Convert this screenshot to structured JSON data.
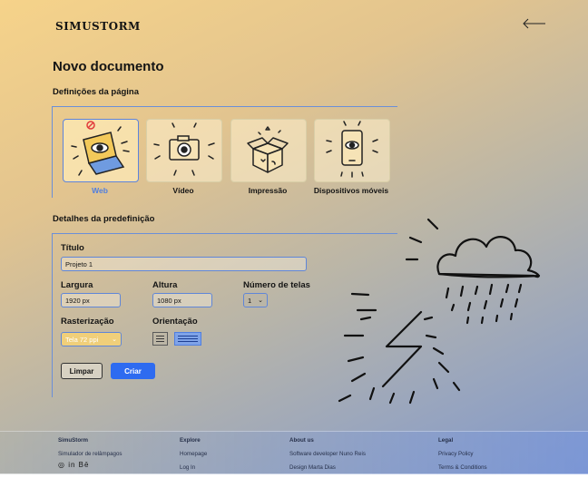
{
  "app": {
    "logo": "SIMUSTORM"
  },
  "header": {
    "back_icon": "arrow-left-icon"
  },
  "page_title": "Novo documento",
  "page_section": {
    "title": "Definições da página",
    "presets": [
      {
        "label": "Web",
        "icon": "laptop-icon",
        "selected": true
      },
      {
        "label": "Vídeo",
        "icon": "camera-icon",
        "selected": false
      },
      {
        "label": "Impressão",
        "icon": "package-icon",
        "selected": false
      },
      {
        "label": "Dispositivos móveis",
        "icon": "phone-icon",
        "selected": false
      }
    ]
  },
  "details_section": {
    "title": "Detalhes da predefinição",
    "title_label": "Título",
    "title_value": "Projeto 1",
    "width_label": "Largura",
    "width_value": "1920 px",
    "height_label": "Altura",
    "height_value": "1080 px",
    "screens_label": "Número de telas",
    "screens_value": "1",
    "raster_label": "Rasterização",
    "raster_value": "Tela 72 ppi",
    "orientation_label": "Orientação",
    "orientation_options": [
      "portrait-icon",
      "landscape-icon"
    ],
    "orientation_selected": "landscape",
    "clear_button": "Limpar",
    "create_button": "Criar"
  },
  "decor": {
    "illustration": "storm-cloud-lightning-icon"
  },
  "footer": {
    "col1": {
      "head": "SimuStorm",
      "item1": "Simulador de relâmpagos",
      "social": "◎ in Bē"
    },
    "col2": {
      "head": "Explore",
      "item1": "Homepage",
      "item2": "Log In"
    },
    "col3": {
      "head": "About us",
      "item1": "Software developer Nuno Reis",
      "item2": "Design Marta Dias"
    },
    "col4": {
      "head": "Legal",
      "item1": "Privacy Policy",
      "item2": "Terms & Conditions"
    }
  },
  "colors": {
    "accent": "#2e6bf0",
    "active_label": "#4f7ee0",
    "raster_bg": "#f0cf7a"
  }
}
